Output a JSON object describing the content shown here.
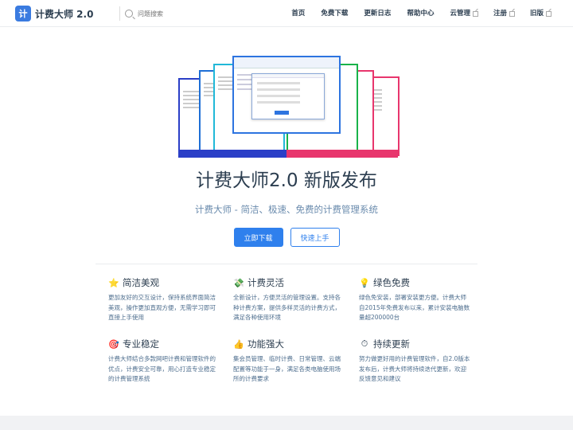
{
  "navbar": {
    "logo_text": "计",
    "brand": "计费大师 2.0",
    "search_placeholder": "问题搜索",
    "links": [
      {
        "label": "首页",
        "external": false
      },
      {
        "label": "免费下载",
        "external": false
      },
      {
        "label": "更新日志",
        "external": false
      },
      {
        "label": "帮助中心",
        "external": false
      },
      {
        "label": "云管理",
        "external": true
      },
      {
        "label": "注册",
        "external": true
      },
      {
        "label": "旧版",
        "external": true
      }
    ]
  },
  "hero": {
    "title": "计费大师2.0 新版发布",
    "subtitle": "计费大师 - 简洁、极速、免费的计费管理系统",
    "primary_action": "立即下载",
    "secondary_action": "快速上手"
  },
  "features": [
    {
      "icon": "star-icon",
      "emoji": "⭐",
      "title": "简洁美观",
      "text": "更加友好的交互设计，保持系统界面简洁美观，操作更加直观方便，无需学习即可直接上手使用"
    },
    {
      "icon": "money-icon",
      "emoji": "💸",
      "title": "计费灵活",
      "text": "全新设计，方便灵活的管理设置。支持各种计费方案，提供多样灵活的计费方式，满足各种使用环境"
    },
    {
      "icon": "bulb-icon",
      "emoji": "💡",
      "title": "绿色免费",
      "text": "绿色免安装，部署安装更方便。计费大师自2015年免费发布以来，累计安装电脑数量超200000台"
    },
    {
      "icon": "target-icon",
      "emoji": "🎯",
      "title": "专业稳定",
      "text": "计费大师结合多款网吧计费和管理软件的优点，计费安全可靠，用心打造专业稳定的计费管理系统"
    },
    {
      "icon": "thumbs-up-icon",
      "emoji": "👍",
      "title": "功能强大",
      "text": "集会员管理、临时计费、日常管理、云端配置等功能于一身，满足各类电脑使用场所的计费要求"
    },
    {
      "icon": "stopwatch-icon",
      "emoji": "⏱",
      "title": "持续更新",
      "text": "努力做更好用的计费管理软件，自2.0版本发布后，计费大师将持续迭代更新，欢迎反馈意见和建议"
    }
  ],
  "colors": {
    "accent": "#2f80ed",
    "text": "#2c3e50",
    "muted": "#4e6e8e"
  }
}
